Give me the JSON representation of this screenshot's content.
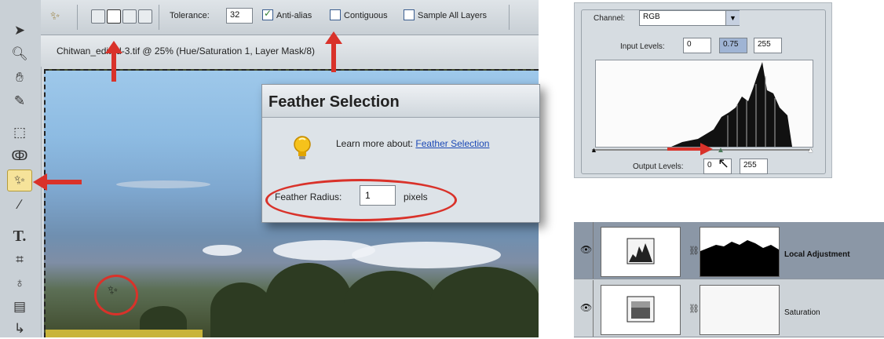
{
  "toolbar": {
    "tolerance_label": "Tolerance:",
    "tolerance_value": "32",
    "anti_alias_label": "Anti-alias",
    "anti_alias_checked": true,
    "contiguous_label": "Contiguous",
    "contiguous_checked": false,
    "sample_all_label": "Sample All Layers",
    "sample_all_checked": false
  },
  "document": {
    "title": "Chitwan_edited-3.tif @ 25% (Hue/Saturation 1, Layer Mask/8)"
  },
  "dialog": {
    "title": "Feather Selection",
    "learn_more": "Learn more about:",
    "learn_link": "Feather Selection",
    "radius_label": "Feather Radius:",
    "radius_value": "1",
    "radius_unit": "pixels"
  },
  "levels": {
    "channel_label": "Channel:",
    "channel_value": "RGB",
    "input_label": "Input Levels:",
    "input_black": "0",
    "input_gray": "0.75",
    "input_white": "255",
    "output_label": "Output Levels:",
    "output_black": "0",
    "output_white": "255"
  },
  "layers": [
    {
      "name": "Local Adjustment",
      "selected": true
    },
    {
      "name": "Saturation",
      "selected": false
    }
  ],
  "colors": {
    "accent_red": "#d9322a",
    "link_blue": "#1a48b5",
    "selected_layer": "#8b97a6"
  }
}
